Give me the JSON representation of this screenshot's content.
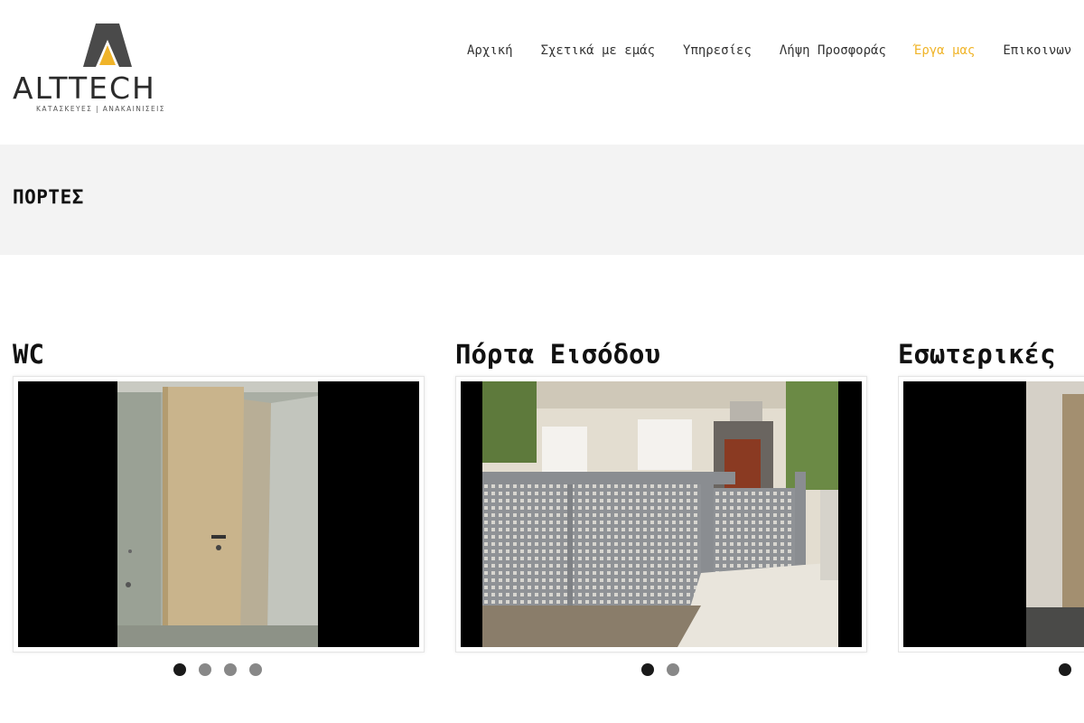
{
  "brand": {
    "name": "ALTTECH",
    "tagline": "ΚΑΤΑΣΚΕΥΕΣ | ΑΝΑΚΑΙΝΙΣΕΙΣ",
    "accent": "#f0b429"
  },
  "nav": {
    "items": [
      {
        "label": "Αρχική"
      },
      {
        "label": "Σχετικά με εμάς"
      },
      {
        "label": "Υπηρεσίες"
      },
      {
        "label": "Λήψη Προσφοράς"
      },
      {
        "label": "Έργα μας"
      },
      {
        "label": "Επικοινων"
      }
    ],
    "active_index": 4
  },
  "page": {
    "title": "ΠΟΡΤΕΣ"
  },
  "cards": [
    {
      "title": "WC",
      "slides": 4,
      "active_slide": 0
    },
    {
      "title": "Πόρτα Εισόδου",
      "slides": 2,
      "active_slide": 0
    },
    {
      "title": "Εσωτερικές",
      "slides": 1,
      "active_slide": 0
    }
  ]
}
